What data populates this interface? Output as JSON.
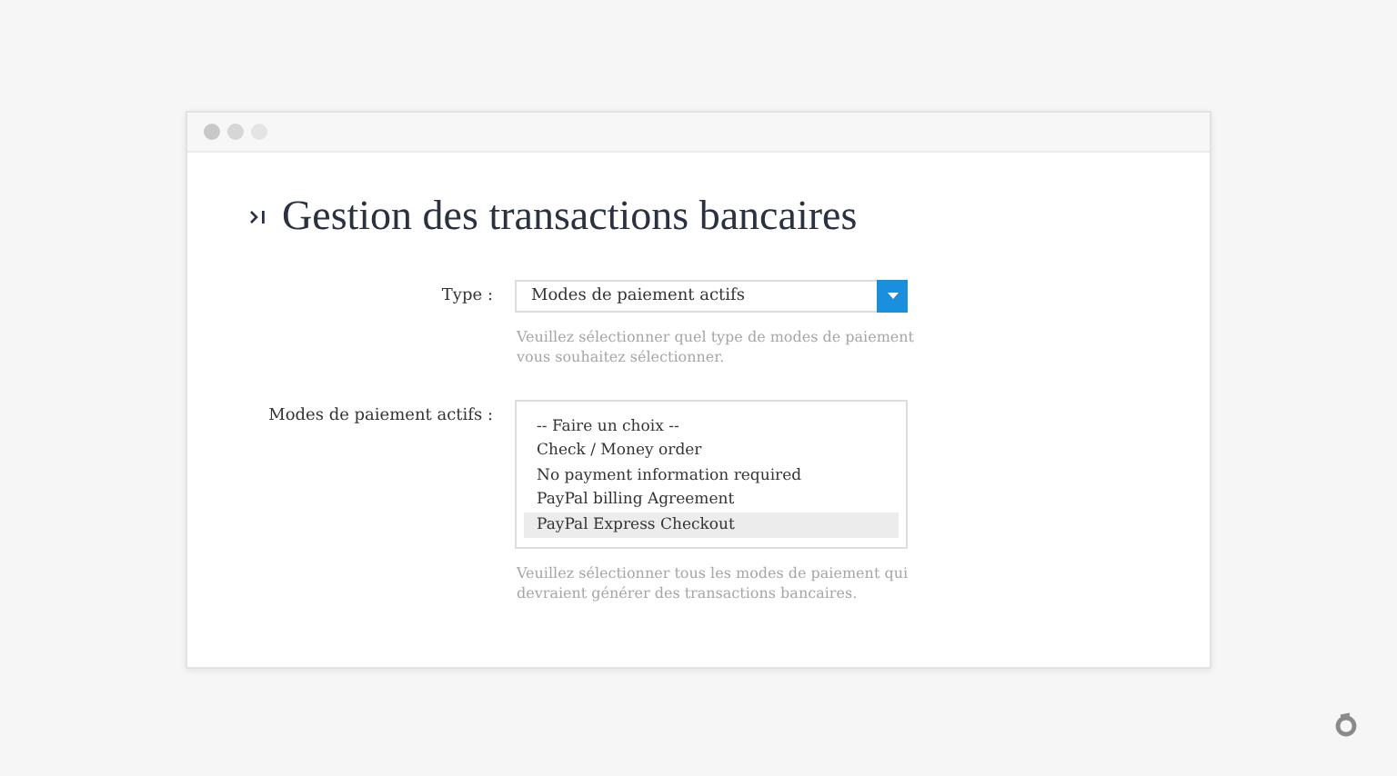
{
  "title": "Gestion des transactions bancaires",
  "type_field": {
    "label": "Type :",
    "value": "Modes de paiement actifs",
    "hint": "Veuillez sélectionner quel type de modes de paiement vous souhaitez sélectionner."
  },
  "methods_field": {
    "label": "Modes de paiement actifs :",
    "hint": "Veuillez sélectionner tous les modes de paiement qui devraient générer des transactions bancaires.",
    "options": [
      {
        "label": "-- Faire un choix --",
        "selected": false
      },
      {
        "label": "Check / Money order",
        "selected": false
      },
      {
        "label": "No payment information required",
        "selected": false
      },
      {
        "label": "PayPal billing Agreement",
        "selected": false
      },
      {
        "label": "PayPal Express Checkout",
        "selected": true
      }
    ]
  }
}
